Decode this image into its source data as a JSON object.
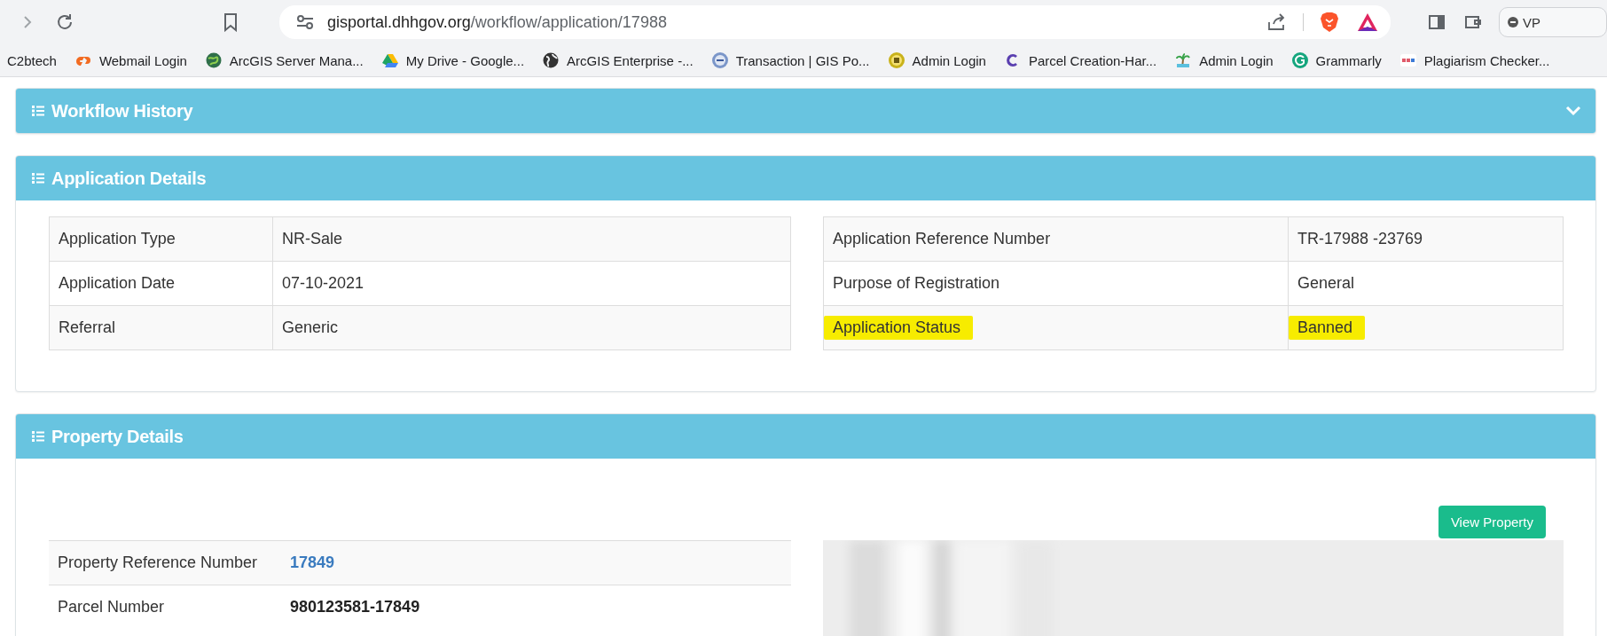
{
  "browser": {
    "url_host": "gisportal.dhhgov.org",
    "url_path": "/workflow/application/17988",
    "vpn_label": "VP",
    "bookmarks": [
      {
        "label": "C2btech"
      },
      {
        "label": "Webmail Login"
      },
      {
        "label": "ArcGIS Server Mana..."
      },
      {
        "label": "My Drive - Google..."
      },
      {
        "label": "ArcGIS Enterprise -..."
      },
      {
        "label": "Transaction | GIS Po..."
      },
      {
        "label": "Admin Login"
      },
      {
        "label": "Parcel Creation-Har..."
      },
      {
        "label": "Admin Login"
      },
      {
        "label": "Grammarly"
      },
      {
        "label": "Plagiarism Checker..."
      }
    ]
  },
  "workflow_history": {
    "title": "Workflow History",
    "expanded": false
  },
  "application_details": {
    "title": "Application Details",
    "left_table": [
      {
        "label": "Application Type",
        "value": "NR-Sale"
      },
      {
        "label": "Application Date",
        "value": "07-10-2021"
      },
      {
        "label": "Referral",
        "value": "Generic"
      }
    ],
    "right_table": [
      {
        "label": "Application Reference Number",
        "value": "TR-17988 -23769",
        "highlighted": false
      },
      {
        "label": "Purpose of Registration",
        "value": "General",
        "highlighted": false
      },
      {
        "label": "Application Status",
        "value": "Banned",
        "highlighted": true
      }
    ]
  },
  "property_details": {
    "title": "Property Details",
    "button": "View Property",
    "rows": [
      {
        "label": "Property Reference Number",
        "value": "17849",
        "kind": "link"
      },
      {
        "label": "Parcel Number",
        "value": "980123581-17849",
        "kind": "bold"
      }
    ]
  }
}
